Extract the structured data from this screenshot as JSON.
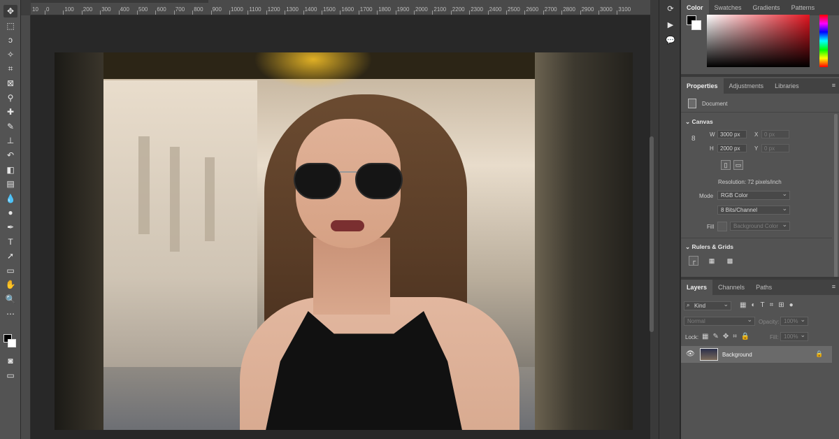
{
  "ruler": {
    "labels": [
      "0",
      "100",
      "200",
      "300",
      "400",
      "500",
      "600",
      "700",
      "800",
      "900",
      "1000",
      "1100",
      "1200",
      "1300",
      "1400",
      "1500",
      "1600",
      "1700",
      "1800",
      "1900",
      "2000",
      "2100",
      "2200",
      "2300",
      "2400",
      "2500",
      "2600",
      "2700",
      "2800",
      "2900",
      "3000",
      "3100"
    ],
    "first_label": "10"
  },
  "tools": [
    {
      "name": "move-tool",
      "icon": "✥"
    },
    {
      "name": "marquee-tool",
      "icon": "⬚"
    },
    {
      "name": "lasso-tool",
      "icon": "ↄ"
    },
    {
      "name": "magic-wand-tool",
      "icon": "✧"
    },
    {
      "name": "crop-tool",
      "icon": "⌗"
    },
    {
      "name": "frame-tool",
      "icon": "⊠"
    },
    {
      "name": "eyedropper-tool",
      "icon": "⚲"
    },
    {
      "name": "healing-brush-tool",
      "icon": "✚"
    },
    {
      "name": "brush-tool",
      "icon": "✎"
    },
    {
      "name": "clone-stamp-tool",
      "icon": "⊥"
    },
    {
      "name": "history-brush-tool",
      "icon": "↶"
    },
    {
      "name": "eraser-tool",
      "icon": "◧"
    },
    {
      "name": "gradient-tool",
      "icon": "▤"
    },
    {
      "name": "blur-tool",
      "icon": "💧"
    },
    {
      "name": "dodge-tool",
      "icon": "●"
    },
    {
      "name": "pen-tool",
      "icon": "✒"
    },
    {
      "name": "type-tool",
      "icon": "T"
    },
    {
      "name": "path-selection-tool",
      "icon": "➚"
    },
    {
      "name": "rectangle-tool",
      "icon": "▭"
    },
    {
      "name": "hand-tool",
      "icon": "✋"
    },
    {
      "name": "zoom-tool",
      "icon": "🔍"
    },
    {
      "name": "more-tools",
      "icon": "⋯"
    }
  ],
  "color_panel": {
    "tabs": [
      "Color",
      "Swatches",
      "Gradients",
      "Patterns"
    ],
    "fg": "#000000",
    "bg": "#ffffff"
  },
  "properties_panel": {
    "tabs": [
      "Properties",
      "Adjustments",
      "Libraries"
    ],
    "document_label": "Document",
    "canvas_heading": "Canvas",
    "w_label": "W",
    "w_value": "3000 px",
    "h_label": "H",
    "h_value": "2000 px",
    "x_label": "X",
    "x_placeholder": "0 px",
    "y_label": "Y",
    "y_placeholder": "0 px",
    "resolution": "Resolution: 72 pixels/inch",
    "mode_label": "Mode",
    "mode_value": "RGB Color",
    "bits_value": "8 Bits/Channel",
    "fill_label": "Fill",
    "fill_value": "Background Color",
    "rulers_heading": "Rulers & Grids"
  },
  "layers_panel": {
    "tabs": [
      "Layers",
      "Channels",
      "Paths"
    ],
    "kind_placeholder": "Kind",
    "blend_mode": "Normal",
    "opacity_label": "Opacity:",
    "opacity_value": "100%",
    "lock_label": "Lock:",
    "fill_label": "Fill:",
    "fill_value": "100%",
    "layers": [
      {
        "name": "Background",
        "visible": true,
        "locked": true
      }
    ]
  },
  "colors": {
    "accent": "#e2141f",
    "panel": "#535353",
    "workspace": "#282828"
  }
}
